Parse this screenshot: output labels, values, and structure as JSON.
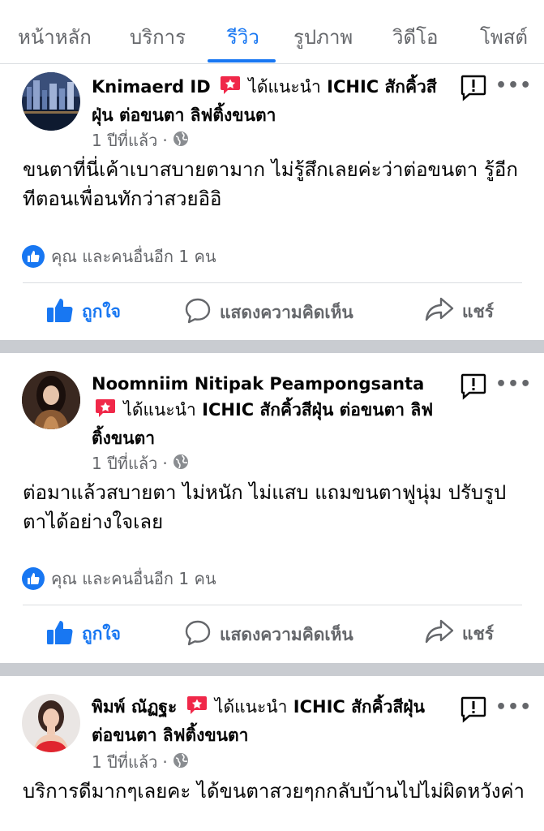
{
  "tabs": [
    {
      "label": "หน้าหลัก",
      "active": false
    },
    {
      "label": "บริการ",
      "active": false
    },
    {
      "label": "รีวิว",
      "active": true
    },
    {
      "label": "รูปภาพ",
      "active": false
    },
    {
      "label": "วิดีโอ",
      "active": false
    },
    {
      "label": "โพสต์",
      "active": false
    }
  ],
  "colors": {
    "accent": "#1877f2",
    "recommend_badge": "#f02849",
    "secondary_text": "#65676b"
  },
  "posts": [
    {
      "author": "Knimaerd ID",
      "recommends_text": "ได้แนะนำ",
      "page_name": "ICHIC สักคิ้วสีฝุ่น ต่อขนตา ลิฟติ้งขนตา",
      "time": "1 ปีที่แล้ว",
      "privacy_icon": "globe-icon",
      "text": "ขนตาที่นี่เค้าเบาสบายตามาก ไม่รู้สึกเลยค่ะว่าต่อขนตา รู้อีกทีตอนเพื่อนทักว่าสวยอิอิ",
      "reactions": "คุณ และคนอื่นอีก 1 คน",
      "like_label": "ถูกใจ",
      "comment_label": "แสดงความคิดเห็น",
      "share_label": "แชร์"
    },
    {
      "author": "Noomniim Nitipak Peampongsanta",
      "recommends_text": "ได้แนะนำ",
      "page_name": "ICHIC สักคิ้วสีฝุ่น ต่อขนตา ลิฟติ้งขนตา",
      "time": "1 ปีที่แล้ว",
      "privacy_icon": "globe-icon",
      "text": "ต่อมาแล้วสบายตา ไม่หนัก ไม่แสบ แถมขนตาฟูนุ่ม ปรับรูปตาได้อย่างใจเลย",
      "reactions": "คุณ และคนอื่นอีก 1 คน",
      "like_label": "ถูกใจ",
      "comment_label": "แสดงความคิดเห็น",
      "share_label": "แชร์"
    },
    {
      "author": "พิมพ์ ณัฏฐะ",
      "recommends_text": "ได้แนะนำ",
      "page_name": "ICHIC สักคิ้วสีฝุ่น ต่อขนตา ลิฟติ้งขนตา",
      "time": "1 ปีที่แล้ว",
      "privacy_icon": "globe-icon",
      "text": "บริการดีมากๆเลยคะ ได้ขนตาสวยๆกกลับบ้านไปไม่ผิดหวังค่า"
    }
  ]
}
